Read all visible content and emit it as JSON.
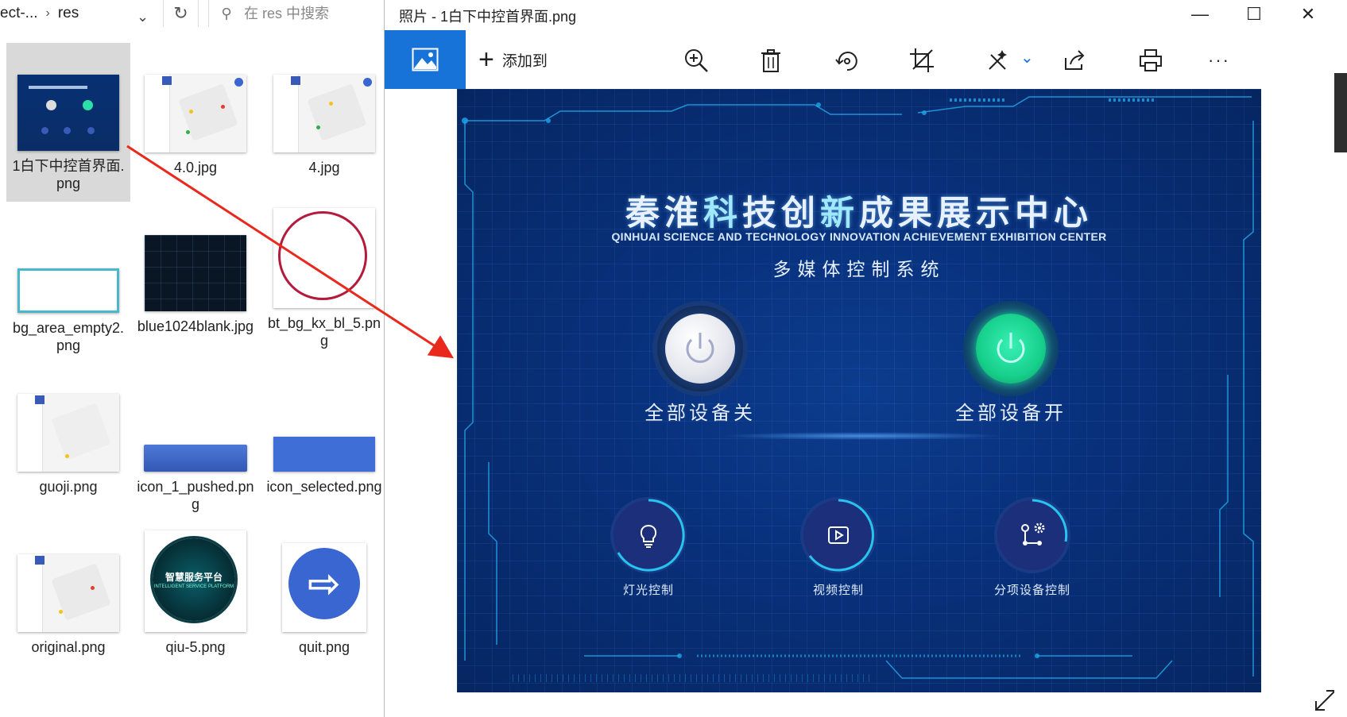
{
  "explorer": {
    "path_prefix": "ect-...",
    "path_current": "res",
    "search_placeholder": "在 res 中搜索",
    "files": [
      {
        "name": "1白下中控首界面.png"
      },
      {
        "name": "4.0.jpg"
      },
      {
        "name": "4.jpg"
      },
      {
        "name": "bg_area_empty2.png"
      },
      {
        "name": "blue1024blank.jpg"
      },
      {
        "name": "bt_bg_kx_bl_5.png"
      },
      {
        "name": "guoji.png"
      },
      {
        "name": "icon_1_pushed.png"
      },
      {
        "name": "icon_selected.png"
      },
      {
        "name": "original.png"
      },
      {
        "name": "qiu-5.png"
      },
      {
        "name": "quit.png"
      }
    ],
    "orb_thumb_title": "智慧服务平台",
    "orb_thumb_subtitle": "INTELLIGENT SERVICE PLATFORM"
  },
  "photos": {
    "title": "照片 - 1白下中控首界面.png",
    "add_to_label": "添加到",
    "toolbar_icons": [
      "zoom-icon",
      "delete-icon",
      "rotate-icon",
      "crop-icon",
      "edit-icon",
      "share-icon",
      "print-icon",
      "more-icon"
    ],
    "more_glyph": "···",
    "image": {
      "title_part1": "秦淮",
      "title_part2": "科",
      "title_part3": "技创",
      "title_part4": "新",
      "title_part5": "成果展示中心",
      "subtitle_en": "QINHUAI SCIENCE AND TECHNOLOGY INNOVATION ACHIEVEMENT EXHIBITION CENTER",
      "system_name": "多媒体控制系统",
      "all_off_label": "全部设备关",
      "all_on_label": "全部设备开",
      "controls": [
        {
          "label": "灯光控制",
          "icon": "lightbulb-icon"
        },
        {
          "label": "视频控制",
          "icon": "video-icon"
        },
        {
          "label": "分项设备控制",
          "icon": "device-settings-icon"
        }
      ]
    }
  },
  "colors": {
    "accent": "#1773d8",
    "image_bg": "#08307a",
    "on_green": "#17d08c",
    "arrow_red": "#e8291c"
  }
}
